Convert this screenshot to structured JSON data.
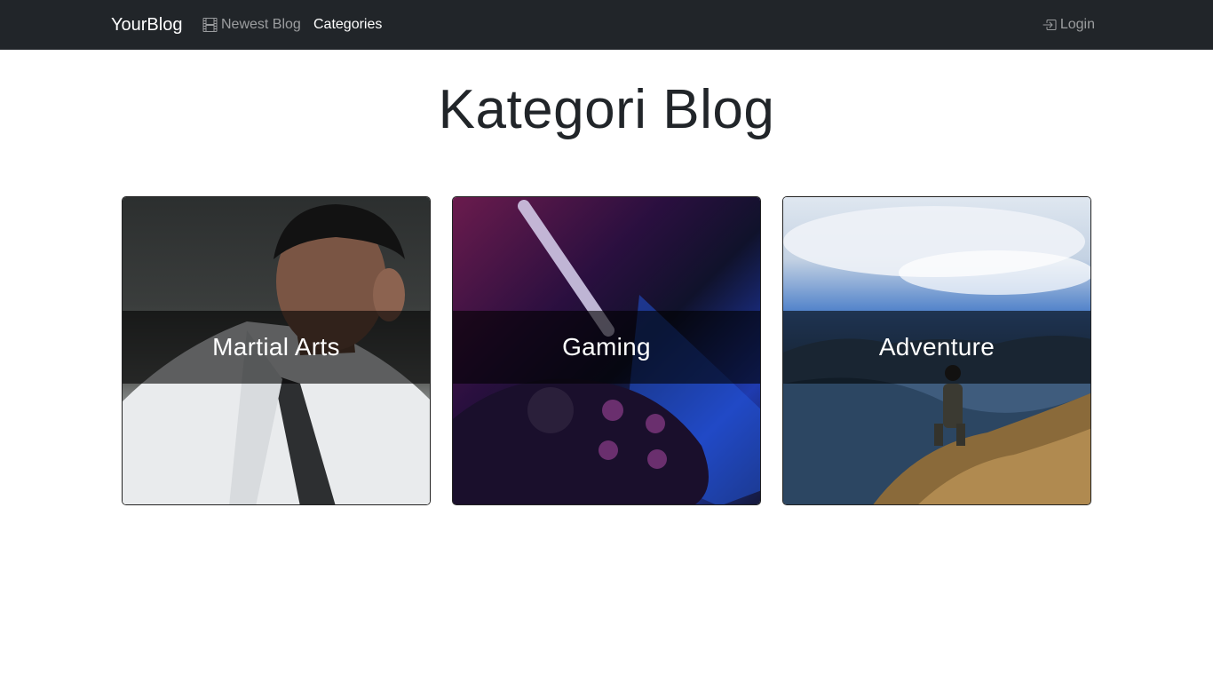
{
  "navbar": {
    "brand": "YourBlog",
    "links": [
      {
        "label": "Newest Blog",
        "icon": "film-icon"
      },
      {
        "label": "Categories"
      }
    ],
    "login": {
      "label": "Login",
      "icon": "box-arrow-in-right-icon"
    }
  },
  "main": {
    "title": "Kategori Blog",
    "categories": [
      {
        "title": "Martial Arts"
      },
      {
        "title": "Gaming"
      },
      {
        "title": "Adventure"
      }
    ]
  },
  "colors": {
    "navbar_bg": "#212529",
    "overlay": "rgba(0,0,0,0.6)"
  }
}
